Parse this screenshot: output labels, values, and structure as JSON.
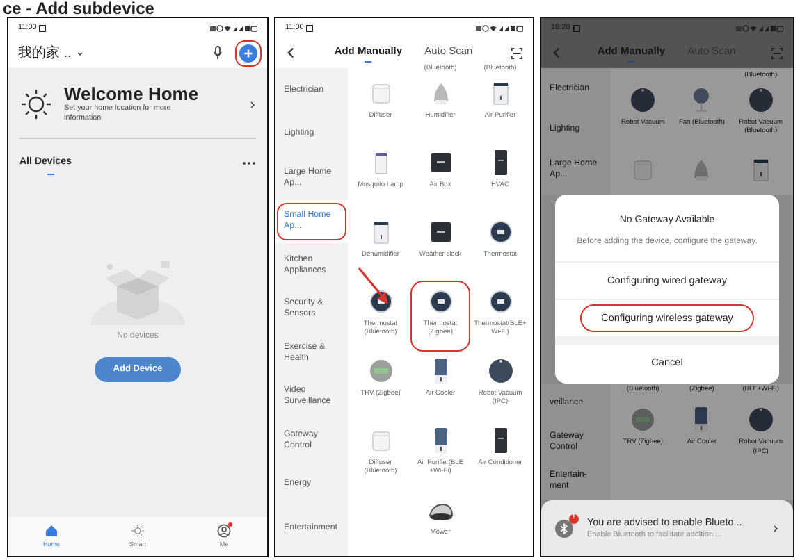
{
  "caption": "ce - Add subdevice",
  "home_screen": {
    "status_time": "11:00",
    "home_name": "我的家 ..",
    "add_highlighted": true,
    "welcome_title": "Welcome Home",
    "welcome_text": "Set your home location for more information",
    "section_title": "All Devices",
    "empty_text": "No devices",
    "add_button": "Add Device",
    "nav": [
      {
        "label": "Home",
        "kind": "home",
        "selected": true,
        "badge": false
      },
      {
        "label": "Smart",
        "kind": "smart",
        "selected": false,
        "badge": false
      },
      {
        "label": "Me",
        "kind": "me",
        "selected": false,
        "badge": true
      }
    ]
  },
  "category_screen": {
    "status_time": "11:00",
    "tabs": [
      {
        "label": "Add Manually",
        "selected": true
      },
      {
        "label": "Auto Scan",
        "selected": false
      }
    ],
    "categories": [
      {
        "label": "Electrician",
        "selected": false,
        "highlighted": false
      },
      {
        "label": "Lighting",
        "selected": false,
        "highlighted": false
      },
      {
        "label": "Large Home Ap...",
        "selected": false,
        "highlighted": false
      },
      {
        "label": "Small Home Ap...",
        "selected": true,
        "highlighted": true
      },
      {
        "label": "Kitchen Appliances",
        "selected": false,
        "highlighted": false
      },
      {
        "label": "Security & Sensors",
        "selected": false,
        "highlighted": false
      },
      {
        "label": "Exercise & Health",
        "selected": false,
        "highlighted": false
      },
      {
        "label": "Video Surveillance",
        "selected": false,
        "highlighted": false
      },
      {
        "label": "Gateway Control",
        "selected": false,
        "highlighted": false
      },
      {
        "label": "Energy",
        "selected": false,
        "highlighted": false
      },
      {
        "label": "Entertainment",
        "selected": false,
        "highlighted": false
      }
    ],
    "device_rows": [
      [
        {
          "kind": "empty"
        },
        {
          "kind": "label",
          "label": "(Bluetooth)",
          "highlighted": false
        },
        {
          "kind": "label",
          "label": "(Bluetooth)",
          "highlighted": false
        }
      ],
      [
        {
          "kind": "cube",
          "label": "Diffuser",
          "highlighted": false
        },
        {
          "kind": "dome",
          "label": "Humidifier",
          "highlighted": false
        },
        {
          "kind": "purifier",
          "label": "Air Purifier",
          "highlighted": false
        }
      ],
      [
        {
          "kind": "lamp",
          "label": "Mosquito Lamp",
          "highlighted": false
        },
        {
          "kind": "panel",
          "label": "Air Box",
          "highlighted": false
        },
        {
          "kind": "tall",
          "label": "HVAC",
          "highlighted": false
        }
      ],
      [
        {
          "kind": "purifier",
          "label": "Dehumidifier",
          "highlighted": false
        },
        {
          "kind": "panel",
          "label": "Weather clock",
          "highlighted": false
        },
        {
          "kind": "disc",
          "label": "Thermostat",
          "highlighted": false
        }
      ],
      [
        {
          "kind": "disc",
          "label": "Thermostat (Bluetooth)",
          "highlighted": false
        },
        {
          "kind": "disc",
          "label": "Thermostat (Zigbee)",
          "highlighted": true
        },
        {
          "kind": "disc",
          "label": "Thermostat(BLE+Wi-Fi)",
          "highlighted": false
        }
      ],
      [
        {
          "kind": "trv",
          "label": "TRV (Zigbee)",
          "highlighted": false
        },
        {
          "kind": "cooler",
          "label": "Air Cooler",
          "highlighted": false
        },
        {
          "kind": "vacuum",
          "label": "Robot Vacuum (IPC)",
          "highlighted": false
        }
      ],
      [
        {
          "kind": "cube",
          "label": "Diffuser (Bluetooth)",
          "highlighted": false
        },
        {
          "kind": "cooler",
          "label": "Air Purifier(BLE +Wi-Fi)",
          "highlighted": false
        },
        {
          "kind": "tall",
          "label": "Air Conditioner",
          "highlighted": false
        }
      ],
      [
        {
          "kind": "mower",
          "label": "Mower",
          "highlighted": false
        }
      ]
    ]
  },
  "gateway_screen": {
    "status_time": "10:20",
    "tabs": [
      {
        "label": "Add Manually",
        "selected": true
      },
      {
        "label": "Auto Scan",
        "selected": false
      }
    ],
    "categories_top": [
      {
        "label": "Electrician"
      },
      {
        "label": "Lighting"
      },
      {
        "label": "Large Home Ap..."
      }
    ],
    "device_rows_top": [
      [
        {
          "kind": "empty"
        },
        {
          "kind": "empty"
        },
        {
          "kind": "label",
          "label": "(Bluetooth)"
        }
      ],
      [
        {
          "kind": "vacuum",
          "label": "Robot Vacuum"
        },
        {
          "kind": "fan",
          "label": "Fan (Bluetooth)"
        },
        {
          "kind": "vacuum",
          "label": "Robot Vacuum (Bluetooth)"
        }
      ],
      [
        {
          "kind": "cube"
        },
        {
          "kind": "dome"
        },
        {
          "kind": "purifier"
        }
      ]
    ],
    "dialog": {
      "title": "No Gateway Available",
      "message": "Before adding the device, configure the gateway.",
      "options": [
        {
          "label": "Configuring wired gateway",
          "kind": "option",
          "highlighted": false
        },
        {
          "label": "Configuring wireless gateway",
          "kind": "option",
          "highlighted": true
        },
        {
          "label": "Cancel",
          "kind": "cancel",
          "highlighted": false
        }
      ]
    },
    "categories_bottom": [
      {
        "label": "veillance"
      },
      {
        "label": "Gateway Control"
      },
      {
        "label": "Entertain-ment"
      }
    ],
    "device_rows_bottom": [
      [
        {
          "kind": "label",
          "label": "(Bluetooth)"
        },
        {
          "kind": "label",
          "label": "(Zigbee)"
        },
        {
          "kind": "label",
          "label": "(BLE+Wi-Fi)"
        }
      ],
      [
        {
          "kind": "trv",
          "label": "TRV (Zigbee)"
        },
        {
          "kind": "cooler",
          "label": "Air Cooler"
        },
        {
          "kind": "vacuum",
          "label": "Robot Vacuum (IPC)"
        }
      ]
    ],
    "toast": {
      "badge": "!",
      "title": "You are advised to enable Blueto...",
      "text": "Enable Bluetooth to facilitate addition ..."
    }
  }
}
